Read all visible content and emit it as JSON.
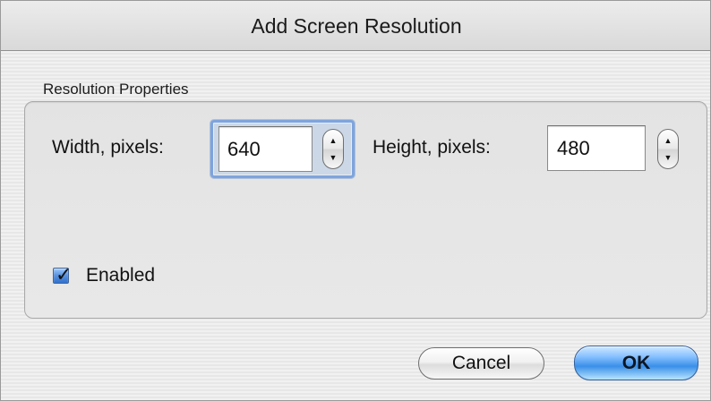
{
  "window": {
    "title": "Add Screen Resolution"
  },
  "properties": {
    "group_label": "Resolution Properties",
    "width": {
      "label": "Width, pixels:",
      "value": "640"
    },
    "height": {
      "label": "Height, pixels:",
      "value": "480"
    },
    "enabled": {
      "label": "Enabled",
      "checked": true
    }
  },
  "buttons": {
    "cancel_label": "Cancel",
    "ok_label": "OK"
  },
  "icons": {
    "stepper_up": "stepper-up-arrow",
    "stepper_down": "stepper-down-arrow",
    "checkbox_checked": "checkmark"
  },
  "colors": {
    "accent": "#4f8fe6",
    "focus": "#7ea4de"
  }
}
